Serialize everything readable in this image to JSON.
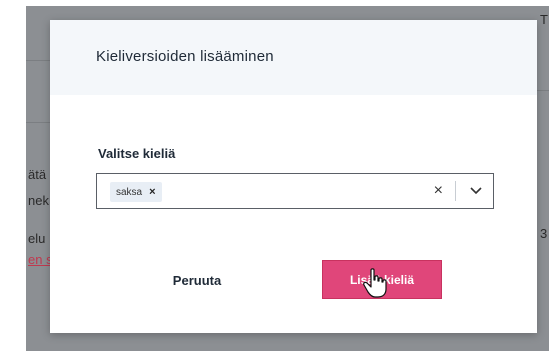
{
  "background": {
    "fragments": [
      {
        "text": "ätä"
      },
      {
        "text": "nek"
      },
      {
        "text": "elu"
      },
      {
        "text": "en s"
      },
      {
        "text": "T"
      },
      {
        "text": "3"
      }
    ]
  },
  "modal": {
    "title": "Kieliversioiden lisääminen",
    "field_label": "Valitse kieliä",
    "selected": [
      {
        "label": "saksa",
        "remove": "×"
      }
    ],
    "clear": "×",
    "cancel_label": "Peruuta",
    "add_label": "Lisää kieliä"
  },
  "colors": {
    "accent": "#e0467a",
    "header_bg": "#f4f7fa",
    "overlay": "#8c8f93"
  },
  "icons": [
    "remove-chip-icon",
    "clear-selection-icon",
    "chevron-down-icon",
    "hand-pointer-icon"
  ]
}
